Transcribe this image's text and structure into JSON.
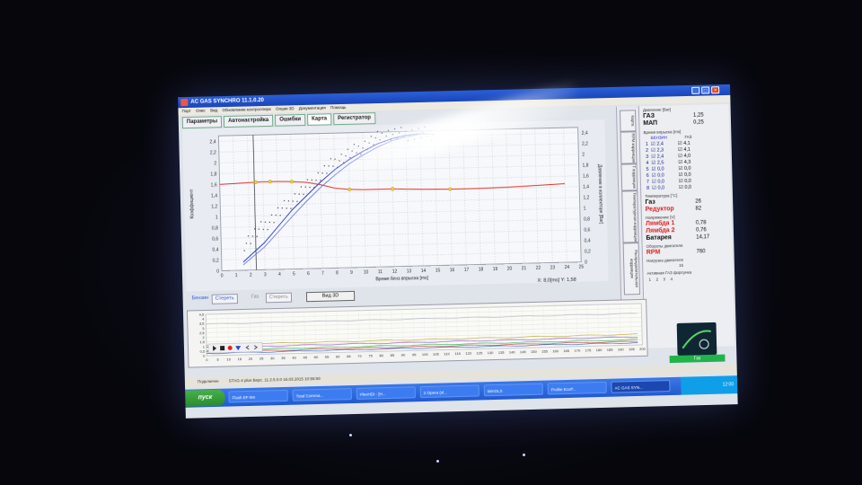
{
  "window": {
    "title": "AC GAS SYNCHRO  11.1.0.20"
  },
  "menu": [
    "Порт",
    "Опис",
    "Вид",
    "Обновление контроллера",
    "Опции 3D",
    "Документация",
    "Помощь"
  ],
  "tabs": [
    "Параметры",
    "Автонастройка",
    "Ошибки",
    "Карта",
    "Регистратор"
  ],
  "vertical_tabs": [
    "Карта",
    "RPM коррекция",
    "Т коррекция",
    "Температурная коррекция",
    "Распределительная коррекция"
  ],
  "side_panel": {
    "pressure_title": "Давление [Bar]",
    "gas_label": "ГАЗ",
    "gas_value": "1,25",
    "map_label": "МАП",
    "map_value": "0,25",
    "inj_title": "Время впрыска [ms]",
    "col_petrol": "БЕНЗИН",
    "col_gas": "ГАЗ",
    "injectors": [
      {
        "n": "1",
        "petrol": "2,4",
        "gas": "4,1"
      },
      {
        "n": "2",
        "petrol": "2,3",
        "gas": "4,1"
      },
      {
        "n": "3",
        "petrol": "2,4",
        "gas": "4,0"
      },
      {
        "n": "4",
        "petrol": "2,5",
        "gas": "4,3"
      },
      {
        "n": "5",
        "petrol": "0,0",
        "gas": "0,0"
      },
      {
        "n": "6",
        "petrol": "0,0",
        "gas": "0,0"
      },
      {
        "n": "7",
        "petrol": "0,0",
        "gas": "0,0"
      },
      {
        "n": "8",
        "petrol": "0,0",
        "gas": "0,0"
      }
    ],
    "temp_title": "Температура [°C]",
    "temp_gas_label": "Газ",
    "temp_gas_value": "26",
    "temp_red_label": "Редуктор",
    "temp_red_value": "82",
    "volt_title": "Напряжение [V]",
    "lambda1_label": "Лямбда 1",
    "lambda1_value": "0,78",
    "lambda2_label": "Лямбда 2",
    "lambda2_value": "0,76",
    "battery_label": "Батарея",
    "battery_value": "14,17",
    "rpm_title": "Обороты двигателя",
    "rpm_label": "RPM",
    "rpm_value": "760",
    "load_title": "Нагрузка двигателя",
    "load_value": "15",
    "active_label": "Активная ГАЗ форсунка",
    "active_nums": [
      "1",
      "2",
      "3",
      "4"
    ]
  },
  "chart_labels": {
    "ylabel": "Коэффициент",
    "xlabel": "Время бенз впрыска [ms]",
    "y2label": "Давление в коллекторе [Bar]",
    "cursor_readout": "X: 8,0[ms]  Y: 1,58"
  },
  "chart_data": {
    "type": "line",
    "x_ticks": [
      "0",
      "1",
      "2",
      "3",
      "4",
      "5",
      "6",
      "7",
      "8",
      "9",
      "10",
      "11",
      "12",
      "13",
      "14",
      "15",
      "16",
      "17",
      "18",
      "19",
      "20",
      "21",
      "22",
      "23",
      "24",
      "25"
    ],
    "y_ticks": [
      "0",
      "0,2",
      "0,4",
      "0,6",
      "0,8",
      "1",
      "1,2",
      "1,4",
      "1,6",
      "1,8",
      "2",
      "2,2",
      "2,4"
    ],
    "xlim": [
      0,
      25
    ],
    "ylim": [
      0,
      2.5
    ],
    "series": [
      {
        "name": "",
        "color": "#e0382b",
        "x": [
          0,
          2,
          3,
          4,
          5,
          6,
          7,
          8,
          9,
          10,
          12,
          14,
          16,
          18,
          20,
          22,
          24
        ],
        "y": [
          1.6,
          1.62,
          1.63,
          1.63,
          1.62,
          1.6,
          1.55,
          1.48,
          1.45,
          1.44,
          1.44,
          1.42,
          1.41,
          1.41,
          1.42,
          1.44,
          1.46
        ]
      },
      {
        "name": "",
        "color": "#1e2fd0",
        "x": [
          1.5,
          3,
          4,
          5,
          6,
          7,
          8,
          9,
          10,
          11,
          12,
          13,
          14,
          15
        ],
        "y": [
          0.15,
          0.5,
          0.8,
          1.1,
          1.35,
          1.6,
          1.82,
          2.0,
          2.15,
          2.28,
          2.37,
          2.43,
          2.45,
          2.44
        ]
      },
      {
        "name": "",
        "color": "#6a78e8",
        "x": [
          1.5,
          3,
          4,
          5,
          6,
          7,
          8,
          9,
          10,
          11,
          12,
          13,
          14,
          15
        ],
        "y": [
          0.1,
          0.42,
          0.7,
          0.98,
          1.25,
          1.5,
          1.72,
          1.92,
          2.08,
          2.22,
          2.33,
          2.4,
          2.44,
          2.44
        ]
      }
    ],
    "markers_x": [
      2.5,
      3.5,
      5,
      9,
      12,
      16
    ]
  },
  "controls": {
    "petrol_label": "Бензин",
    "clear_label": "Стереть",
    "gas_label": "Газ",
    "clear2_label": "Стереть",
    "view3d_label": "Вид 3D"
  },
  "scope": {
    "y_ticks": [
      "0",
      "0,5",
      "1",
      "1,5",
      "2",
      "2,5",
      "3",
      "3,5",
      "4",
      "4,5"
    ],
    "x_ticks": [
      "0",
      "5",
      "10",
      "15",
      "20",
      "25",
      "30",
      "35",
      "40",
      "45",
      "50",
      "55",
      "60",
      "65",
      "70",
      "75",
      "80",
      "85",
      "90",
      "95",
      "100",
      "105",
      "110",
      "115",
      "120",
      "125",
      "130",
      "135",
      "140",
      "145",
      "150",
      "155",
      "160",
      "165",
      "170",
      "175",
      "180",
      "185",
      "190",
      "195",
      "200"
    ]
  },
  "logo": {
    "gaz_label": "Газ"
  },
  "status": {
    "line1": "Подключен",
    "line2": "STAG-4 plus  Верс. 11.2.5.0.0   16.03.2015 10:56:50"
  },
  "taskbar": {
    "start_label": "пуск",
    "items": [
      "Flash EF-9m",
      "Total Comma...",
      "PlexHDI - [H...",
      "2 Opera (sl...",
      "WinOLS",
      "Prolite EcoP...",
      "AC GAS SYN..."
    ],
    "clock": "12:00"
  }
}
